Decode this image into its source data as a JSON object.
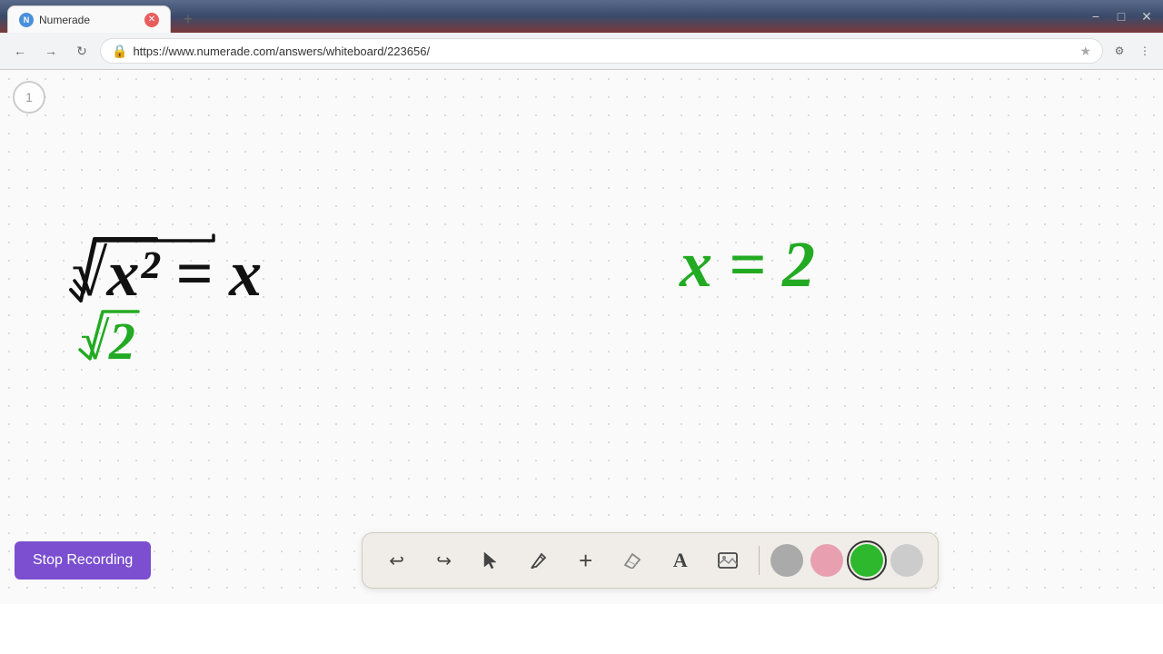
{
  "browser": {
    "tab_title": "Numerade",
    "url": "https://www.numerade.com/answers/whiteboard/223656/",
    "new_tab_label": "+",
    "nav": {
      "back_label": "←",
      "forward_label": "→",
      "refresh_label": "↻"
    },
    "window_controls": {
      "minimize": "−",
      "maximize": "□",
      "close": "✕"
    }
  },
  "whiteboard": {
    "page_number": "1",
    "math_content": {
      "top_left": "√x² = x",
      "bottom_left": "√2",
      "right": "x = 2"
    }
  },
  "toolbar": {
    "stop_recording_label": "Stop Recording",
    "tools": [
      {
        "name": "undo",
        "icon": "↩",
        "label": "Undo"
      },
      {
        "name": "redo",
        "icon": "↪",
        "label": "Redo"
      },
      {
        "name": "select",
        "icon": "▲",
        "label": "Select"
      },
      {
        "name": "pen",
        "icon": "✏",
        "label": "Pen"
      },
      {
        "name": "add",
        "icon": "+",
        "label": "Add"
      },
      {
        "name": "eraser",
        "icon": "⌫",
        "label": "Eraser"
      },
      {
        "name": "text",
        "icon": "A",
        "label": "Text"
      },
      {
        "name": "image",
        "icon": "🖼",
        "label": "Image"
      }
    ],
    "colors": [
      {
        "name": "gray",
        "value": "#aaaaaa",
        "selected": false
      },
      {
        "name": "pink",
        "value": "#e8a0b0",
        "selected": false
      },
      {
        "name": "green",
        "value": "#2db82d",
        "selected": true
      },
      {
        "name": "light-gray",
        "value": "#cccccc",
        "selected": false
      }
    ]
  }
}
